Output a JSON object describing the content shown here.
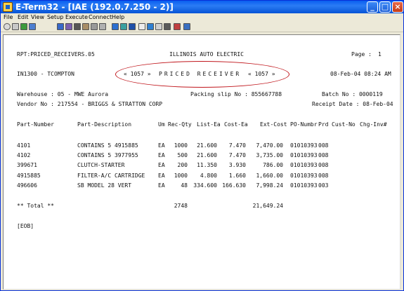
{
  "window": {
    "title": "E-Term32 - [IAE (192.0.7.250 - 2)]"
  },
  "menu": [
    "File",
    "Edit",
    "View",
    "Setup",
    "Execute",
    "Connect",
    "Help"
  ],
  "toolbar_icons": [
    "new-session-icon",
    "open-icon",
    "connect-icon",
    "disconnect-icon",
    "print-icon",
    "copy-icon",
    "paste-icon",
    "send-icon",
    "receive-icon",
    "capture-icon",
    "settings-icon",
    "keyboard-icon",
    "color-icon",
    "font-icon",
    "zoom-icon",
    "macro-icon",
    "script-icon",
    "file-transfer-icon",
    "help-icon"
  ],
  "report": {
    "rpt": "RPT:PRICED_RECEIVERS.05",
    "company": "ILLINOIS AUTO ELECTRIC",
    "page_label": "Page :",
    "page_num": "1",
    "user": "IN1300 - TCOMPTON",
    "code_left": "« 1057 »",
    "banner": "PRICED RECEIVER",
    "code_right": "« 1057 »",
    "date_time": "08-Feb-04 08:24 AM",
    "warehouse": "Warehouse : 05 - MWE Aurora",
    "packing_slip": "Packing slip No : 855667788",
    "batch": "Batch No : 0000119",
    "vendor": "Vendor No : 217554 - BRIGGS & STRATTON CORP",
    "receipt_date": "Receipt Date : 08-Feb-04",
    "columns": [
      "Part-Number",
      "Part-Description",
      "Um",
      "Rec-Qty",
      "List-Ea",
      "Cost-Ea",
      "Ext-Cost",
      "PO-Numbr",
      "Prd",
      "Cust-No",
      "Chg-Inv#"
    ],
    "rows": [
      {
        "part": "4101",
        "desc": "CONTAINS 5 4915885",
        "um": "EA",
        "qty": "1000",
        "list": "21.600",
        "cost": "7.470",
        "ext": "7,470.00",
        "po": "01010393",
        "prd": "008"
      },
      {
        "part": "4102",
        "desc": "CONTAINS 5 3977955",
        "um": "EA",
        "qty": "500",
        "list": "21.600",
        "cost": "7.470",
        "ext": "3,735.00",
        "po": "01010393",
        "prd": "008"
      },
      {
        "part": "399671",
        "desc": "CLUTCH-STARTER",
        "um": "EA",
        "qty": "200",
        "list": "11.350",
        "cost": "3.930",
        "ext": "786.00",
        "po": "01010393",
        "prd": "008"
      },
      {
        "part": "4915885",
        "desc": "FILTER-A/C CARTRIDGE",
        "um": "EA",
        "qty": "1000",
        "list": "4.800",
        "cost": "1.660",
        "ext": "1,660.00",
        "po": "01010393",
        "prd": "008"
      },
      {
        "part": "496606",
        "desc": "SB MODEL 28 VERT",
        "um": "EA",
        "qty": "48",
        "list": "334.600",
        "cost": "166.630",
        "ext": "7,998.24",
        "po": "01010393",
        "prd": "003"
      }
    ],
    "total_label": "** Total **",
    "total_qty": "2748",
    "total_ext": "21,649.24",
    "eob": "[EOB]"
  }
}
